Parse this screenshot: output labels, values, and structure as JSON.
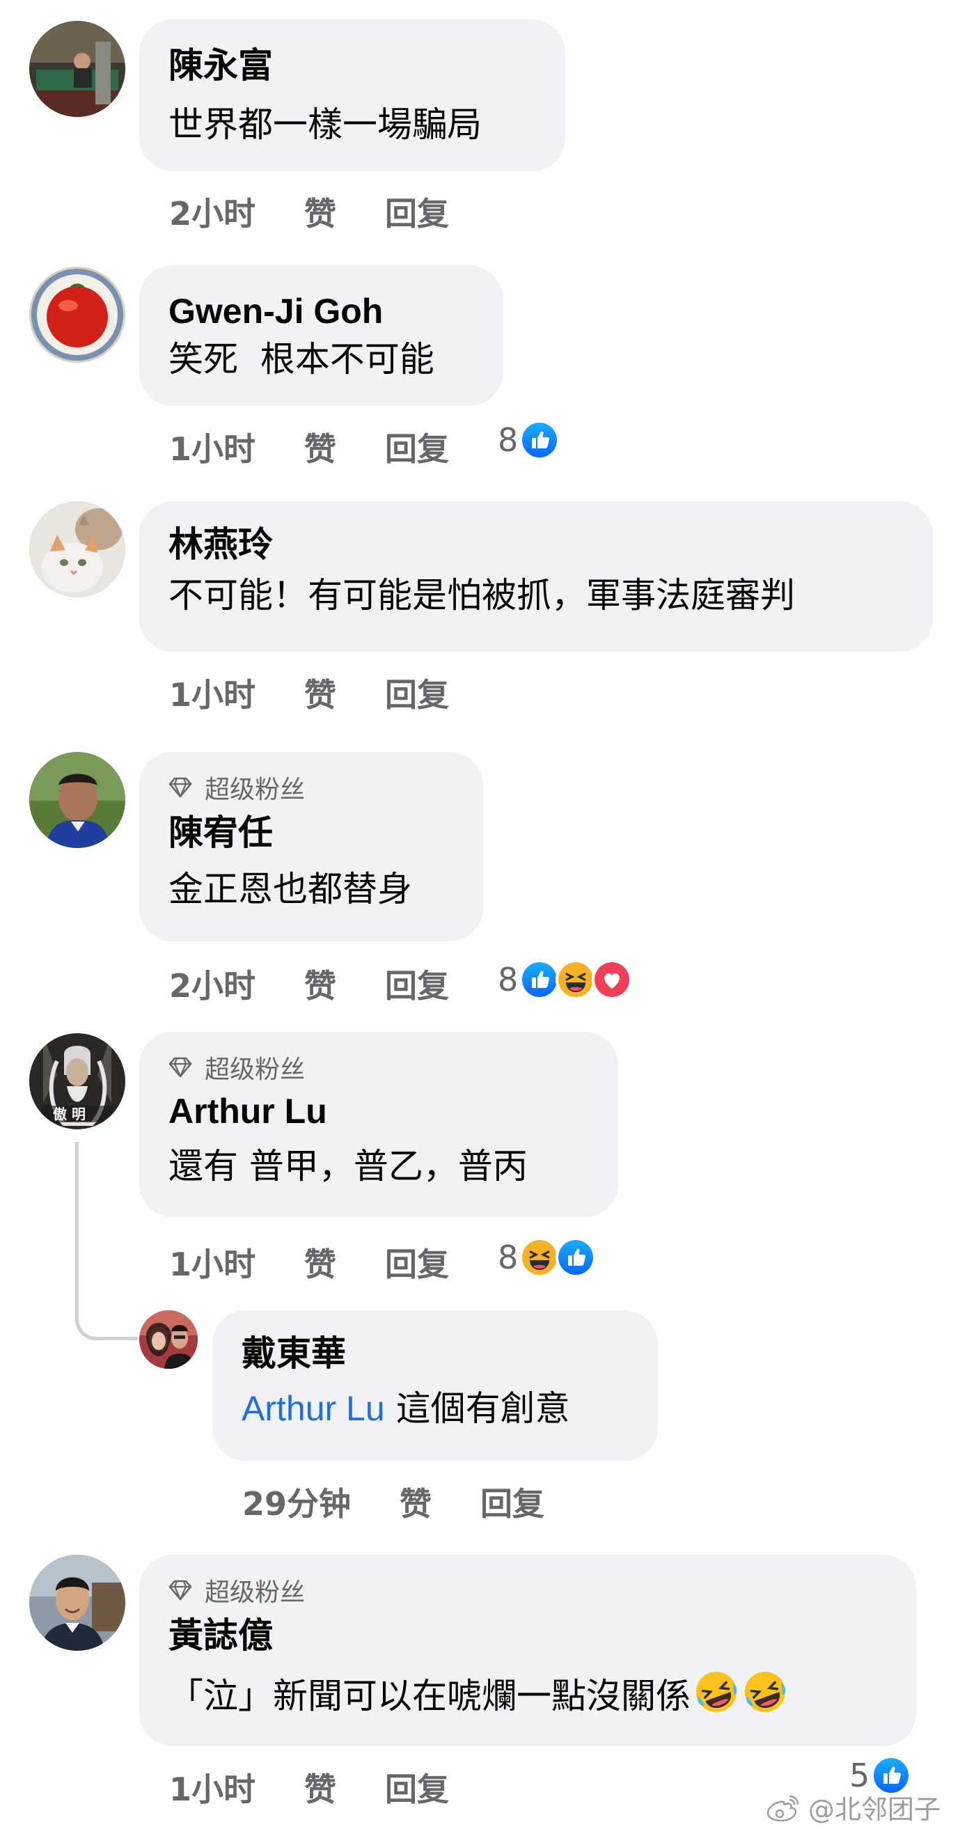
{
  "actions": {
    "like": "赞",
    "reply": "回复"
  },
  "badge_label": "超级粉丝",
  "comments": [
    {
      "author": "陳永富",
      "text": "世界都一樣一場騙局",
      "time": "2小时",
      "reaction_count": "",
      "reactions": []
    },
    {
      "author": "Gwen-Ji Goh",
      "text": "笑死  根本不可能",
      "time": "1小时",
      "reaction_count": "8",
      "reactions": [
        "like-icon"
      ]
    },
    {
      "author": "林燕玲",
      "text": "不可能！有可能是怕被抓，軍事法庭審判",
      "time": "1小时",
      "reaction_count": "",
      "reactions": []
    },
    {
      "author": "陳宥任",
      "badge": true,
      "text": "金正恩也都替身",
      "time": "2小时",
      "reaction_count": "8",
      "reactions": [
        "like-icon",
        "haha-icon",
        "love-icon"
      ]
    },
    {
      "author": "Arthur Lu",
      "badge": true,
      "text": "還有 普甲，普乙，普丙",
      "time": "1小时",
      "reaction_count": "8",
      "reactions": [
        "haha-icon",
        "like-icon"
      ]
    },
    {
      "author": "戴東華",
      "is_reply": true,
      "mention": "Arthur Lu",
      "text": "這個有創意",
      "time": "29分钟",
      "reaction_count": "",
      "reactions": []
    },
    {
      "author": "黃誌億",
      "badge": true,
      "text": "「泣」新聞可以在唬爛一點沒關係",
      "trailing_emoji": [
        "rofl-icon",
        "rofl-icon"
      ],
      "time": "1小时",
      "reaction_count": "5",
      "reactions": [
        "like-icon"
      ]
    }
  ],
  "watermark": "@北邻团子",
  "colors": {
    "bubble": "#f0f2f5",
    "meta": "#65676b",
    "mention": "#216fdb",
    "like": "#1877f2",
    "love": "#f33e58",
    "haha": "#f7b125"
  }
}
